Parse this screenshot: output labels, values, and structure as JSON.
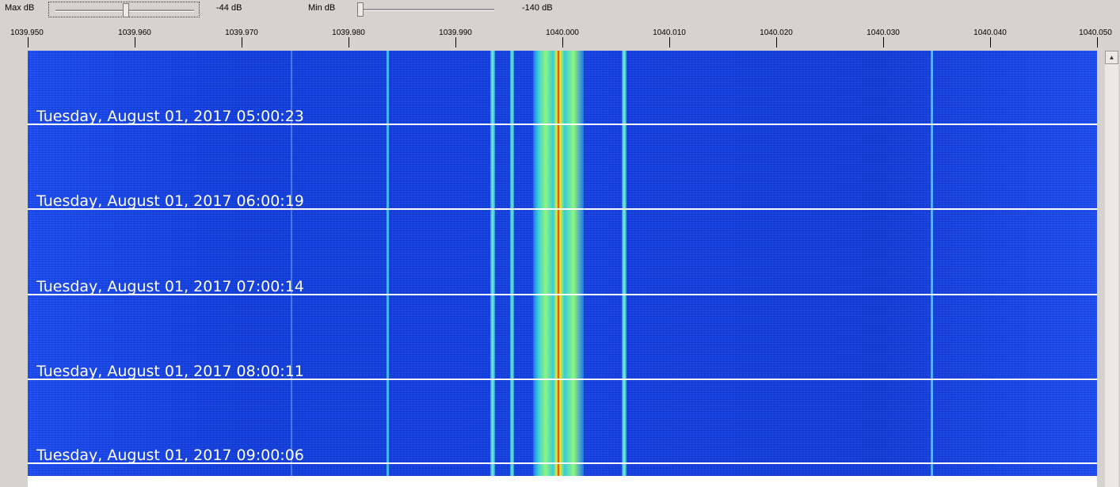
{
  "controls": {
    "max_db": {
      "label": "Max dB",
      "value_text": "-44 dB",
      "level": 0.48
    },
    "min_db": {
      "label": "Min dB",
      "value_text": "-140 dB",
      "level": 0.0
    }
  },
  "frequency_axis": {
    "ticks": [
      "1039.950",
      "1039.960",
      "1039.970",
      "1039.980",
      "1039.990",
      "1040.000",
      "1040.010",
      "1040.020",
      "1040.030",
      "1040.040",
      "1040.050"
    ]
  },
  "waterfall": {
    "timestamps": [
      "Tuesday, August 01, 2017 05:00:23",
      "Tuesday, August 01, 2017 06:00:19",
      "Tuesday, August 01, 2017 07:00:14",
      "Tuesday, August 01, 2017 08:00:11",
      "Tuesday, August 01, 2017 09:00:06"
    ]
  },
  "scrollbar": {
    "up_arrow": "up-arrow-icon"
  }
}
